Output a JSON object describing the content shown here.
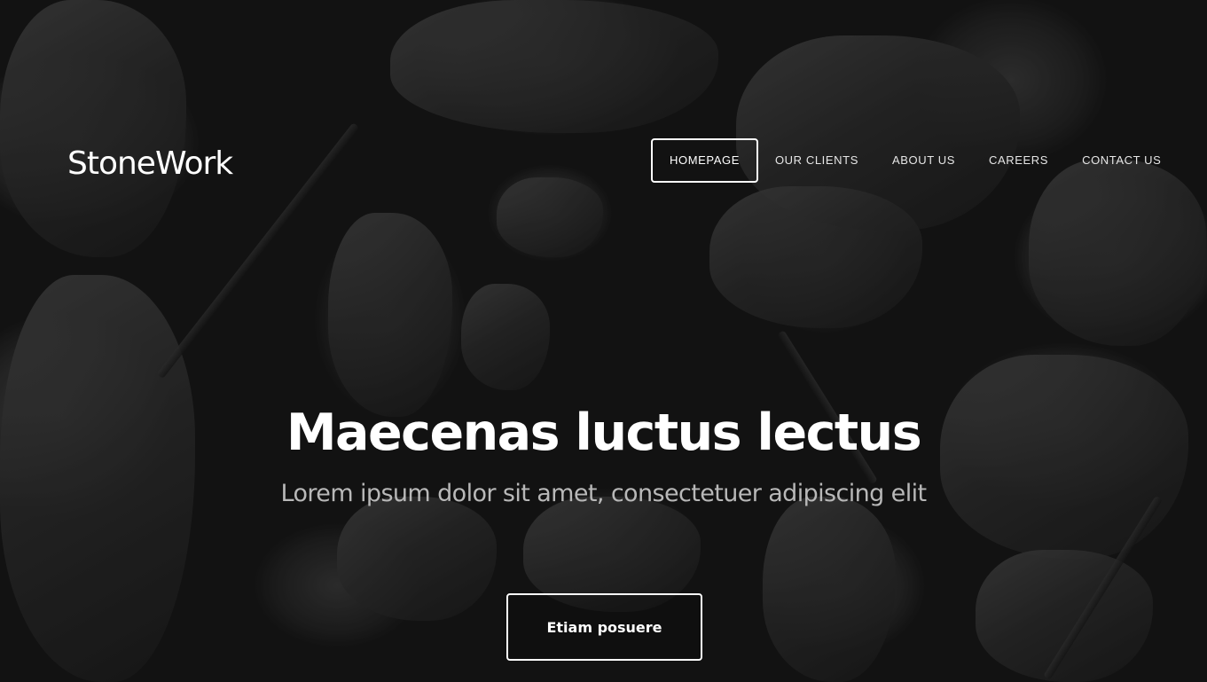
{
  "brand": {
    "logo_text": "StoneWork"
  },
  "nav": {
    "items": [
      {
        "label": "HOMEPAGE",
        "active": true
      },
      {
        "label": "OUR CLIENTS",
        "active": false
      },
      {
        "label": "ABOUT US",
        "active": false
      },
      {
        "label": "CAREERS",
        "active": false
      },
      {
        "label": "CONTACT US",
        "active": false
      }
    ]
  },
  "hero": {
    "title": "Maecenas luctus lectus",
    "subtitle": "Lorem ipsum dolor sit amet, consectetuer adipiscing elit",
    "cta_label": "Etiam posuere",
    "background": "dark rocks photo"
  },
  "colors": {
    "text": "#ffffff",
    "subtitle": "#b8b8b8",
    "background": "#1a1a1a"
  }
}
